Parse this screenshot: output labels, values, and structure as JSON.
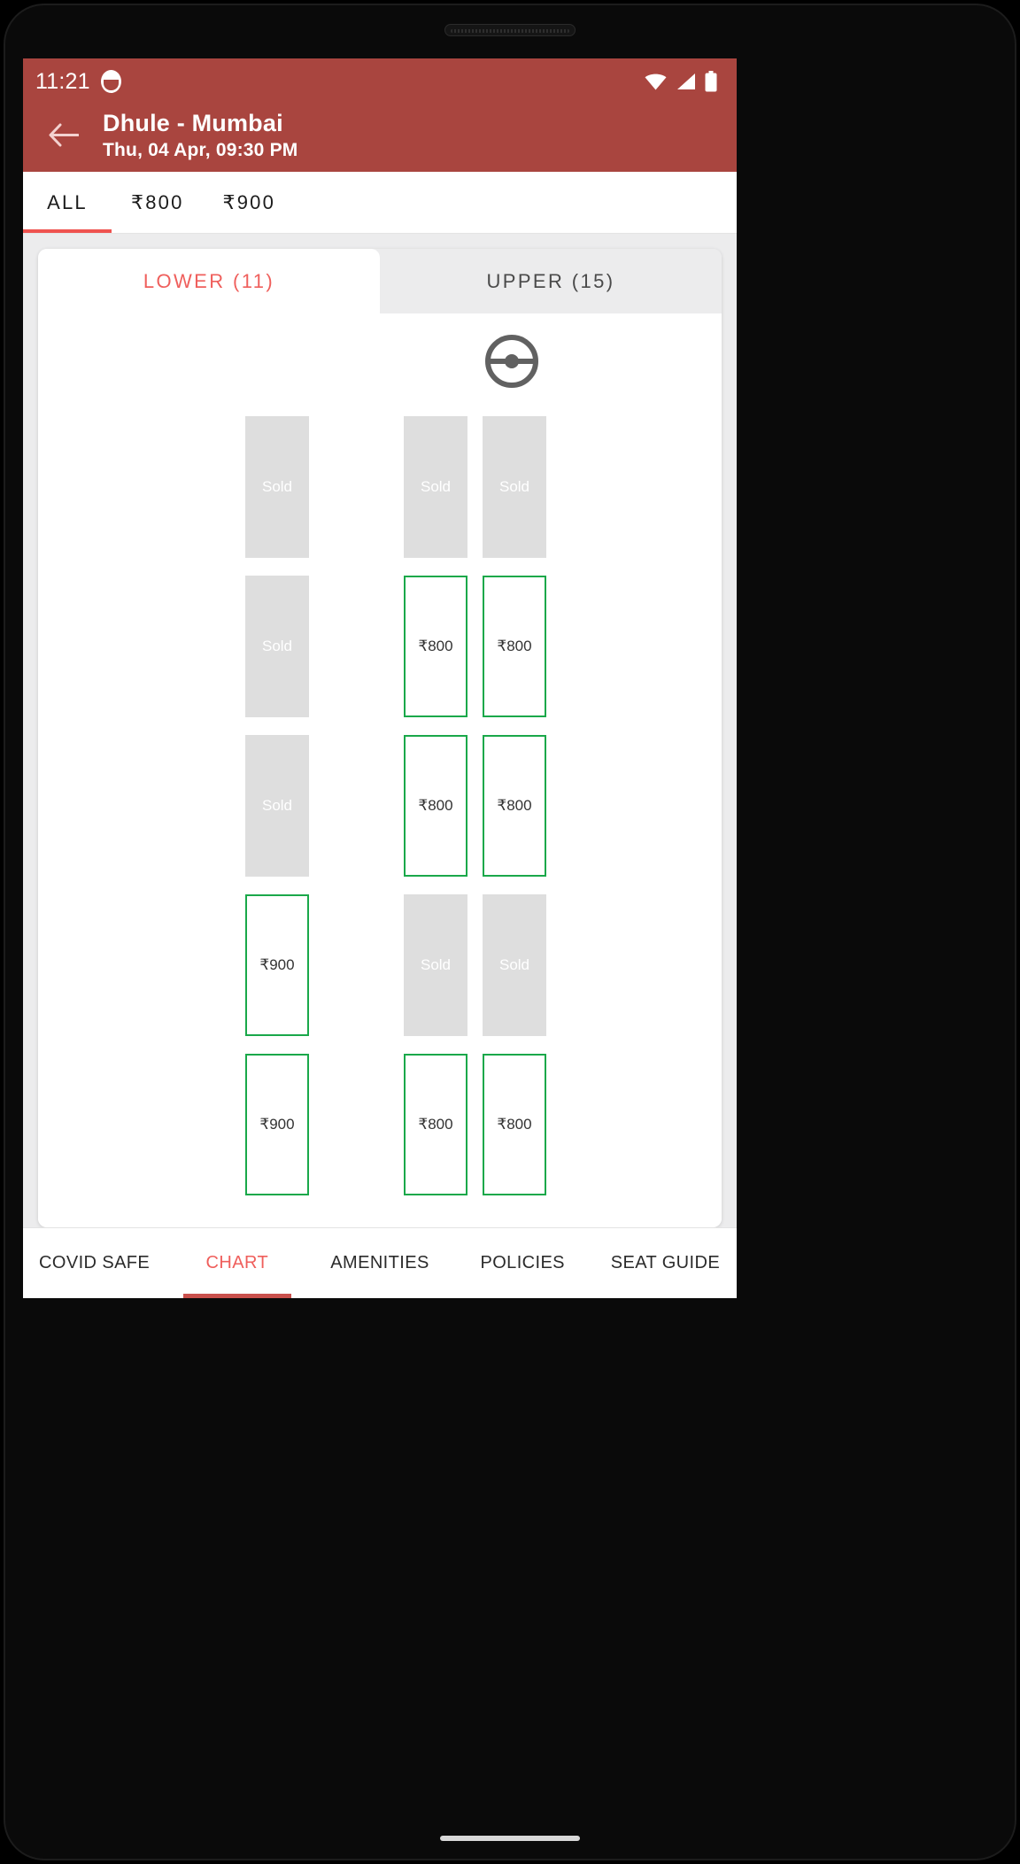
{
  "statusbar": {
    "time": "11:21",
    "app_icon": "app-notification-icon",
    "icons": [
      "wifi-icon",
      "signal-icon",
      "battery-icon"
    ]
  },
  "appbar": {
    "back_icon": "back-arrow-icon",
    "route": "Dhule - Mumbai",
    "datetime": "Thu, 04 Apr,  09:30 PM",
    "bg_color": "#a9453f"
  },
  "price_tabs": [
    {
      "label": "ALL",
      "active": true
    },
    {
      "label": "₹800",
      "active": false
    },
    {
      "label": "₹900",
      "active": false
    }
  ],
  "deck_tabs": [
    {
      "label": "LOWER (11)",
      "active": true
    },
    {
      "label": "UPPER (15)",
      "active": false
    }
  ],
  "seat_map": {
    "driver_icon": "steering-wheel-icon",
    "sold_label": "Sold",
    "colors": {
      "sold": "#dedede",
      "available_border": "#1aa84a",
      "accent": "#ef5f5c"
    },
    "rows": [
      {
        "seats": [
          {
            "col": "c1",
            "state": "sold",
            "label": "Sold"
          },
          {
            "col": "c3",
            "state": "sold",
            "label": "Sold"
          },
          {
            "col": "c4",
            "state": "sold",
            "label": "Sold"
          }
        ]
      },
      {
        "seats": [
          {
            "col": "c1",
            "state": "sold",
            "label": "Sold"
          },
          {
            "col": "c3",
            "state": "avail",
            "label": "₹800"
          },
          {
            "col": "c4",
            "state": "avail",
            "label": "₹800"
          }
        ]
      },
      {
        "seats": [
          {
            "col": "c1",
            "state": "sold",
            "label": "Sold"
          },
          {
            "col": "c3",
            "state": "avail",
            "label": "₹800"
          },
          {
            "col": "c4",
            "state": "avail",
            "label": "₹800"
          }
        ]
      },
      {
        "seats": [
          {
            "col": "c1",
            "state": "avail",
            "label": "₹900"
          },
          {
            "col": "c3",
            "state": "sold",
            "label": "Sold"
          },
          {
            "col": "c4",
            "state": "sold",
            "label": "Sold"
          }
        ]
      },
      {
        "seats": [
          {
            "col": "c1",
            "state": "avail",
            "label": "₹900"
          },
          {
            "col": "c3",
            "state": "avail",
            "label": "₹800"
          },
          {
            "col": "c4",
            "state": "avail",
            "label": "₹800"
          }
        ]
      }
    ]
  },
  "bottom_nav": [
    {
      "label": "COVID SAFE",
      "active": false
    },
    {
      "label": "CHART",
      "active": true
    },
    {
      "label": "AMENITIES",
      "active": false
    },
    {
      "label": "POLICIES",
      "active": false
    },
    {
      "label": "SEAT GUIDE",
      "active": false
    }
  ]
}
